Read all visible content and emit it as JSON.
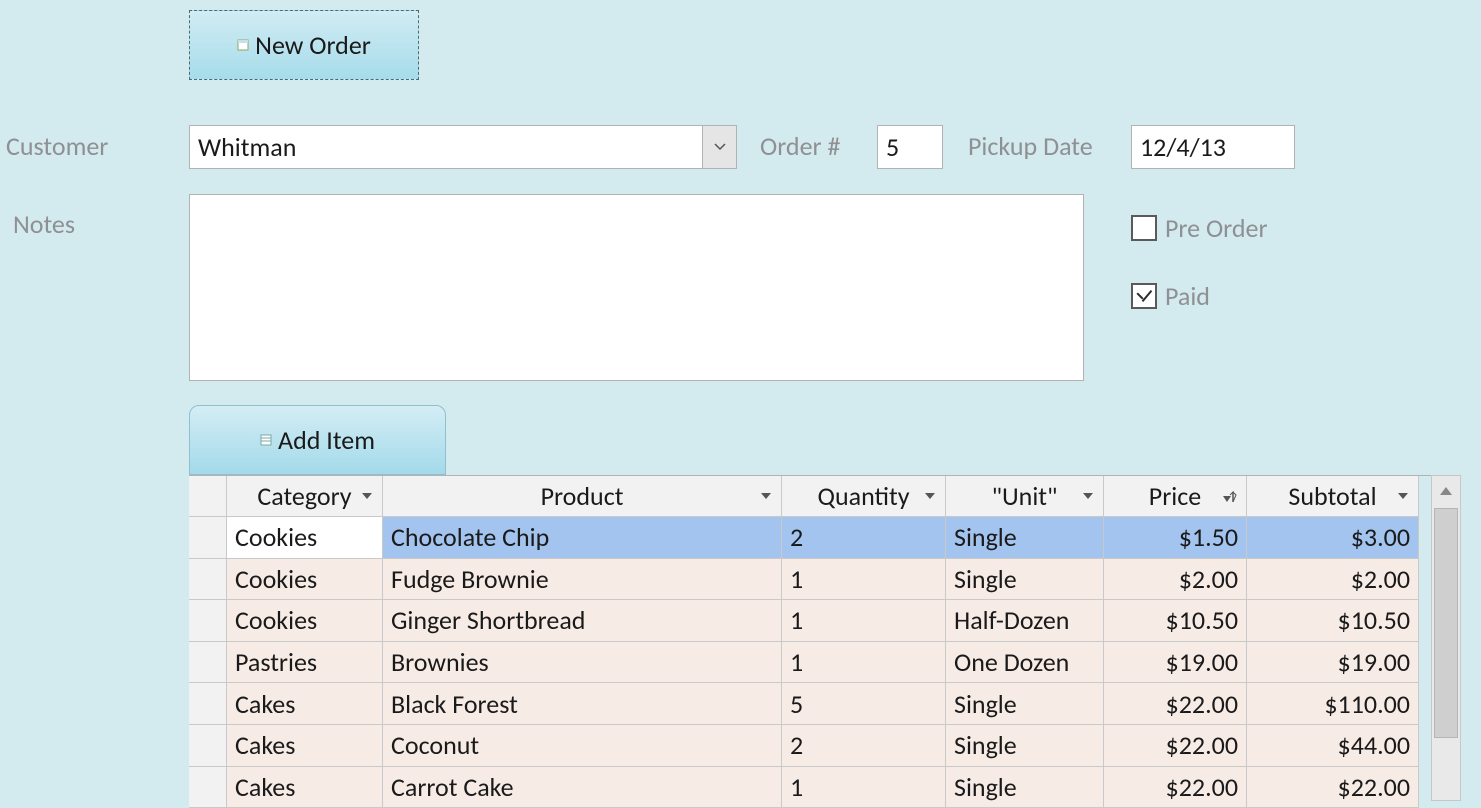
{
  "buttons": {
    "new_order": "New Order",
    "add_item": "Add Item"
  },
  "labels": {
    "customer": "Customer",
    "order_no": "Order #",
    "pickup_date": "Pickup Date",
    "notes": "Notes",
    "pre_order": "Pre Order",
    "paid": "Paid"
  },
  "form": {
    "customer": "Whitman",
    "order_no": "5",
    "pickup_date": "12/4/13",
    "notes": "",
    "pre_order_checked": false,
    "paid_checked": true
  },
  "table": {
    "headers": {
      "category": "Category",
      "product": "Product",
      "quantity": "Quantity",
      "unit": "\"Unit\"",
      "price": "Price",
      "subtotal": "Subtotal"
    },
    "rows": [
      {
        "category": "Cookies",
        "product": "Chocolate Chip",
        "quantity": "2",
        "unit": "Single",
        "price": "$1.50",
        "subtotal": "$3.00"
      },
      {
        "category": "Cookies",
        "product": "Fudge Brownie",
        "quantity": "1",
        "unit": "Single",
        "price": "$2.00",
        "subtotal": "$2.00"
      },
      {
        "category": "Cookies",
        "product": "Ginger Shortbread",
        "quantity": "1",
        "unit": "Half-Dozen",
        "price": "$10.50",
        "subtotal": "$10.50"
      },
      {
        "category": "Pastries",
        "product": "Brownies",
        "quantity": "1",
        "unit": "One Dozen",
        "price": "$19.00",
        "subtotal": "$19.00"
      },
      {
        "category": "Cakes",
        "product": "Black Forest",
        "quantity": "5",
        "unit": "Single",
        "price": "$22.00",
        "subtotal": "$110.00"
      },
      {
        "category": "Cakes",
        "product": "Coconut",
        "quantity": "2",
        "unit": "Single",
        "price": "$22.00",
        "subtotal": "$44.00"
      },
      {
        "category": "Cakes",
        "product": "Carrot Cake",
        "quantity": "1",
        "unit": "Single",
        "price": "$22.00",
        "subtotal": "$22.00"
      }
    ]
  }
}
